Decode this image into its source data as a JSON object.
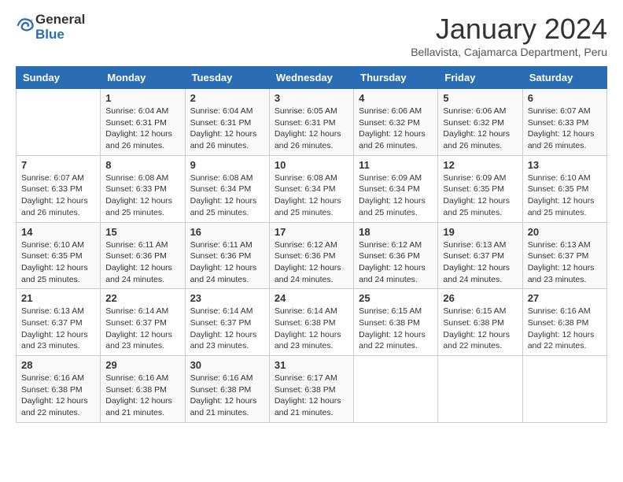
{
  "header": {
    "logo_general": "General",
    "logo_blue": "Blue",
    "month_title": "January 2024",
    "subtitle": "Bellavista, Cajamarca Department, Peru"
  },
  "days_of_week": [
    "Sunday",
    "Monday",
    "Tuesday",
    "Wednesday",
    "Thursday",
    "Friday",
    "Saturday"
  ],
  "weeks": [
    [
      {
        "day": "",
        "sunrise": "",
        "sunset": "",
        "daylight": ""
      },
      {
        "day": "1",
        "sunrise": "6:04 AM",
        "sunset": "6:31 PM",
        "daylight": "12 hours and 26 minutes."
      },
      {
        "day": "2",
        "sunrise": "6:04 AM",
        "sunset": "6:31 PM",
        "daylight": "12 hours and 26 minutes."
      },
      {
        "day": "3",
        "sunrise": "6:05 AM",
        "sunset": "6:31 PM",
        "daylight": "12 hours and 26 minutes."
      },
      {
        "day": "4",
        "sunrise": "6:06 AM",
        "sunset": "6:32 PM",
        "daylight": "12 hours and 26 minutes."
      },
      {
        "day": "5",
        "sunrise": "6:06 AM",
        "sunset": "6:32 PM",
        "daylight": "12 hours and 26 minutes."
      },
      {
        "day": "6",
        "sunrise": "6:07 AM",
        "sunset": "6:33 PM",
        "daylight": "12 hours and 26 minutes."
      }
    ],
    [
      {
        "day": "7",
        "sunrise": "6:07 AM",
        "sunset": "6:33 PM",
        "daylight": "12 hours and 26 minutes."
      },
      {
        "day": "8",
        "sunrise": "6:08 AM",
        "sunset": "6:33 PM",
        "daylight": "12 hours and 25 minutes."
      },
      {
        "day": "9",
        "sunrise": "6:08 AM",
        "sunset": "6:34 PM",
        "daylight": "12 hours and 25 minutes."
      },
      {
        "day": "10",
        "sunrise": "6:08 AM",
        "sunset": "6:34 PM",
        "daylight": "12 hours and 25 minutes."
      },
      {
        "day": "11",
        "sunrise": "6:09 AM",
        "sunset": "6:34 PM",
        "daylight": "12 hours and 25 minutes."
      },
      {
        "day": "12",
        "sunrise": "6:09 AM",
        "sunset": "6:35 PM",
        "daylight": "12 hours and 25 minutes."
      },
      {
        "day": "13",
        "sunrise": "6:10 AM",
        "sunset": "6:35 PM",
        "daylight": "12 hours and 25 minutes."
      }
    ],
    [
      {
        "day": "14",
        "sunrise": "6:10 AM",
        "sunset": "6:35 PM",
        "daylight": "12 hours and 25 minutes."
      },
      {
        "day": "15",
        "sunrise": "6:11 AM",
        "sunset": "6:36 PM",
        "daylight": "12 hours and 24 minutes."
      },
      {
        "day": "16",
        "sunrise": "6:11 AM",
        "sunset": "6:36 PM",
        "daylight": "12 hours and 24 minutes."
      },
      {
        "day": "17",
        "sunrise": "6:12 AM",
        "sunset": "6:36 PM",
        "daylight": "12 hours and 24 minutes."
      },
      {
        "day": "18",
        "sunrise": "6:12 AM",
        "sunset": "6:36 PM",
        "daylight": "12 hours and 24 minutes."
      },
      {
        "day": "19",
        "sunrise": "6:13 AM",
        "sunset": "6:37 PM",
        "daylight": "12 hours and 24 minutes."
      },
      {
        "day": "20",
        "sunrise": "6:13 AM",
        "sunset": "6:37 PM",
        "daylight": "12 hours and 23 minutes."
      }
    ],
    [
      {
        "day": "21",
        "sunrise": "6:13 AM",
        "sunset": "6:37 PM",
        "daylight": "12 hours and 23 minutes."
      },
      {
        "day": "22",
        "sunrise": "6:14 AM",
        "sunset": "6:37 PM",
        "daylight": "12 hours and 23 minutes."
      },
      {
        "day": "23",
        "sunrise": "6:14 AM",
        "sunset": "6:37 PM",
        "daylight": "12 hours and 23 minutes."
      },
      {
        "day": "24",
        "sunrise": "6:14 AM",
        "sunset": "6:38 PM",
        "daylight": "12 hours and 23 minutes."
      },
      {
        "day": "25",
        "sunrise": "6:15 AM",
        "sunset": "6:38 PM",
        "daylight": "12 hours and 22 minutes."
      },
      {
        "day": "26",
        "sunrise": "6:15 AM",
        "sunset": "6:38 PM",
        "daylight": "12 hours and 22 minutes."
      },
      {
        "day": "27",
        "sunrise": "6:16 AM",
        "sunset": "6:38 PM",
        "daylight": "12 hours and 22 minutes."
      }
    ],
    [
      {
        "day": "28",
        "sunrise": "6:16 AM",
        "sunset": "6:38 PM",
        "daylight": "12 hours and 22 minutes."
      },
      {
        "day": "29",
        "sunrise": "6:16 AM",
        "sunset": "6:38 PM",
        "daylight": "12 hours and 21 minutes."
      },
      {
        "day": "30",
        "sunrise": "6:16 AM",
        "sunset": "6:38 PM",
        "daylight": "12 hours and 21 minutes."
      },
      {
        "day": "31",
        "sunrise": "6:17 AM",
        "sunset": "6:38 PM",
        "daylight": "12 hours and 21 minutes."
      },
      {
        "day": "",
        "sunrise": "",
        "sunset": "",
        "daylight": ""
      },
      {
        "day": "",
        "sunrise": "",
        "sunset": "",
        "daylight": ""
      },
      {
        "day": "",
        "sunrise": "",
        "sunset": "",
        "daylight": ""
      }
    ]
  ]
}
